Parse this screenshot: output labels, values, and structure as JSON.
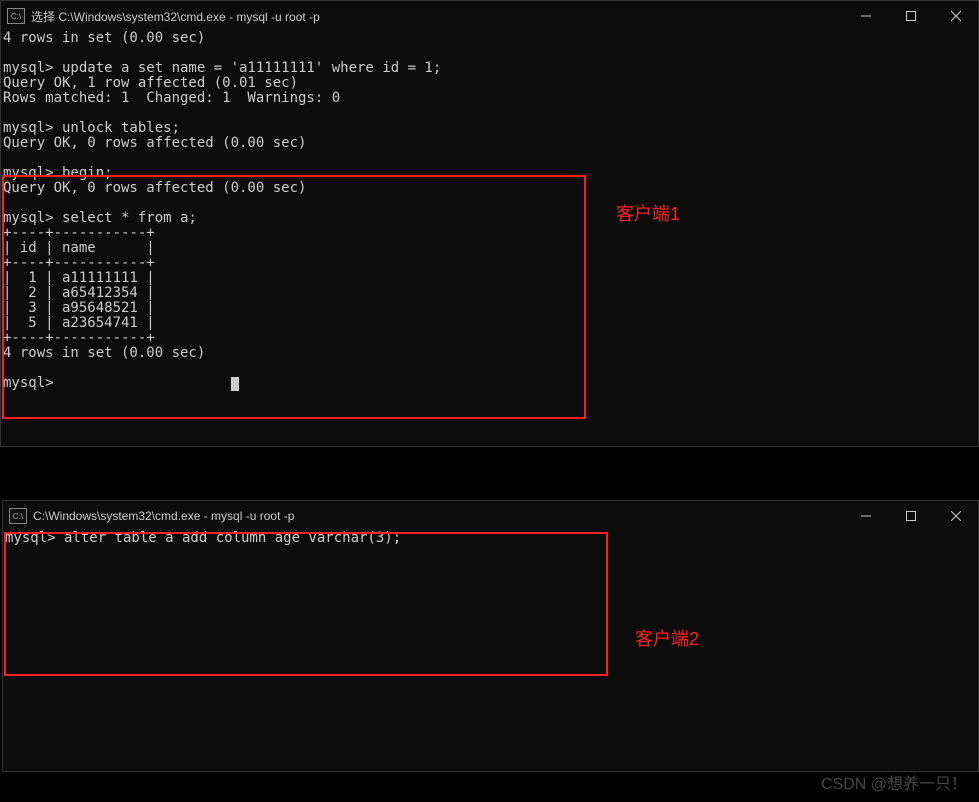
{
  "window1": {
    "title": "选择 C:\\Windows\\system32\\cmd.exe - mysql  -u root -p",
    "controls": {
      "min": "—",
      "max": "□",
      "close": "✕"
    },
    "lines": {
      "l1": "4 rows in set (0.00 sec)",
      "l2": "",
      "l3": "mysql> update a set name = 'a11111111' where id = 1;",
      "l4": "Query OK, 1 row affected (0.01 sec)",
      "l5": "Rows matched: 1  Changed: 1  Warnings: 0",
      "l6": "",
      "l7": "mysql> unlock tables;",
      "l8": "Query OK, 0 rows affected (0.00 sec)",
      "l9": "",
      "l10": "mysql> begin;",
      "l11": "Query OK, 0 rows affected (0.00 sec)",
      "l12": "",
      "l13": "mysql> select * from a;",
      "l14": "+----+-----------+",
      "l15": "| id | name      |",
      "l16": "+----+-----------+",
      "l17": "|  1 | a11111111 |",
      "l18": "|  2 | a65412354 |",
      "l19": "|  3 | a95648521 |",
      "l20": "|  5 | a23654741 |",
      "l21": "+----+-----------+",
      "l22": "4 rows in set (0.00 sec)",
      "l23": "",
      "l24_prompt": "mysql> "
    }
  },
  "window2": {
    "title": "C:\\Windows\\system32\\cmd.exe - mysql  -u root -p",
    "controls": {
      "min": "—",
      "max": "□",
      "close": "✕"
    },
    "lines": {
      "l1": "mysql> alter table a add column age varchar(3);"
    }
  },
  "annotations": {
    "label1": "客户端1",
    "label2": "客户端2"
  },
  "watermark": "CSDN @想养一只！"
}
